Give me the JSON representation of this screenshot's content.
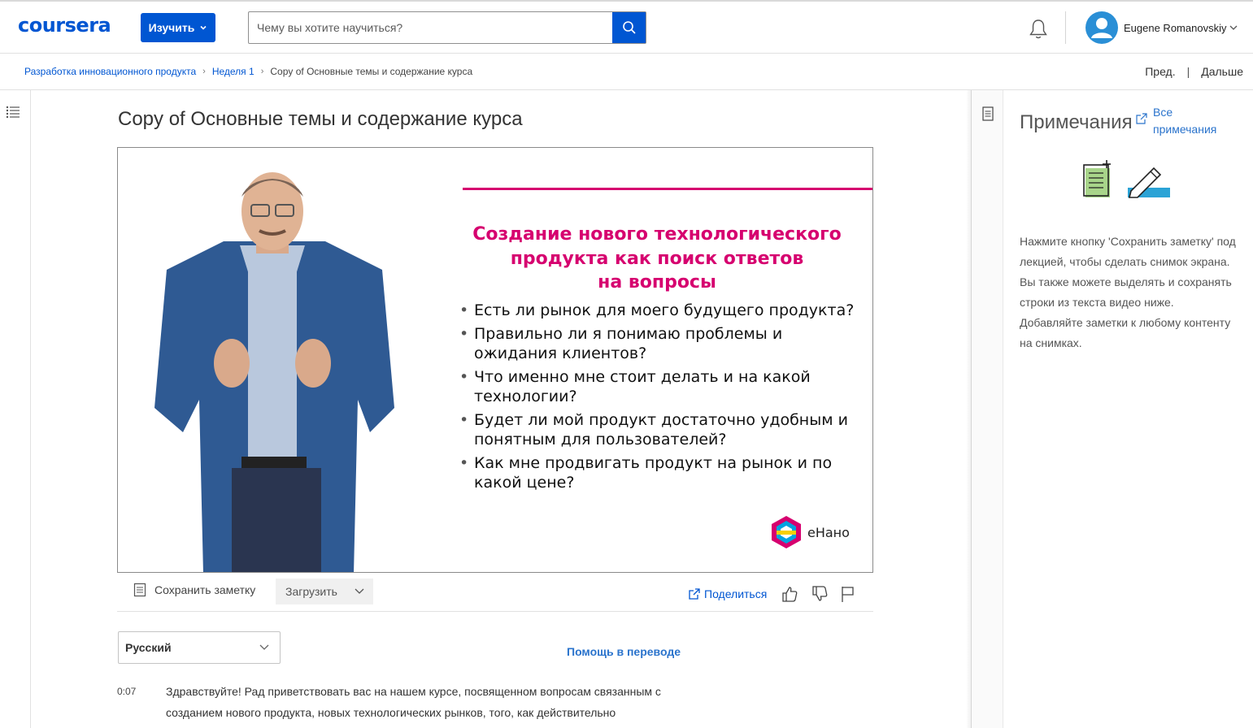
{
  "header": {
    "logo": "coursera",
    "explore_label": "Изучить",
    "search_placeholder": "Чему вы хотите научиться?",
    "user_name": "Eugene Romanovskiy"
  },
  "breadcrumb": {
    "items": [
      "Разработка инновационного продукта",
      "Неделя 1"
    ],
    "current": "Copy of Основные темы и содержание курса"
  },
  "nav": {
    "prev": "Пред.",
    "next": "Дальше"
  },
  "main": {
    "title": "Copy of Основные темы и содержание курса",
    "slide": {
      "heading": "Создание нового технологического продукта как поиск ответов на вопросы",
      "heading_lines": [
        "Создание нового технологического",
        "продукта как поиск ответов",
        "на вопросы"
      ],
      "bullets": [
        "Есть ли рынок для моего будущего продукта?",
        "Правильно ли я понимаю проблемы и ожидания клиентов?",
        "Что именно мне стоит делать и на какой технологии?",
        "Будет ли мой продукт достаточно удобным и понятным для пользователей?",
        "Как мне продвигать продукт на рынок и по какой цене?"
      ],
      "brand": "еНано"
    },
    "toolbar": {
      "save_note": "Сохранить заметку",
      "download": "Загрузить",
      "share": "Поделиться"
    },
    "transcript": {
      "language": "Русский",
      "help_translate": "Помощь в переводе",
      "timestamp": "0:07",
      "text": "Здравствуйте! Рад приветствовать вас на нашем курсе, посвященном вопросам связанным с созданием нового продукта, новых технологических рынков, того, как действительно"
    }
  },
  "notes": {
    "title": "Примечания",
    "all_notes": "Все примечания",
    "help": "Нажмите кнопку 'Сохранить заметку' под лекцией, чтобы сделать снимок экрана. Вы также можете выделять и сохранять строки из текста видео ниже. Добавляйте заметки к любому контенту на снимках."
  },
  "colors": {
    "brand_blue": "#0056d2",
    "slide_magenta": "#d6006f",
    "link_blue": "#2a73cc"
  },
  "icons": [
    "search-icon",
    "bell-icon",
    "avatar-icon",
    "chevron-down-icon",
    "table-of-contents-icon",
    "note-icon",
    "share-icon",
    "thumbs-up-icon",
    "thumbs-down-icon",
    "flag-icon",
    "external-link-icon",
    "notes-icon"
  ]
}
